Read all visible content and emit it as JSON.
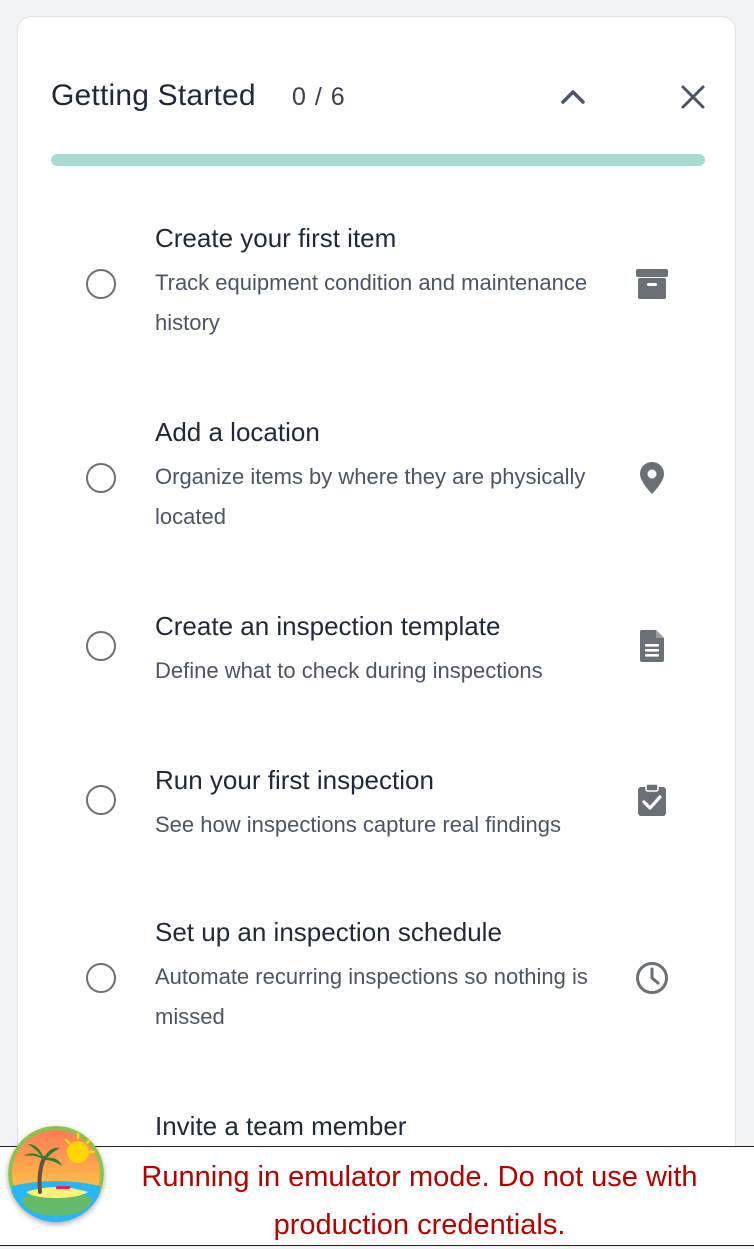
{
  "header": {
    "title": "Getting Started",
    "progress_count": "0 / 6",
    "progress_fraction": 0
  },
  "icons": {
    "collapse": "chevron-up-icon",
    "close": "close-icon"
  },
  "tasks": [
    {
      "title": "Create your first item",
      "description": "Track equipment condition and maintenance history",
      "icon": "archive-box-icon",
      "completed": false
    },
    {
      "title": "Add a location",
      "description": "Organize items by where they are physically located",
      "icon": "map-pin-icon",
      "completed": false
    },
    {
      "title": "Create an inspection template",
      "description": "Define what to check during inspections",
      "icon": "document-icon",
      "completed": false
    },
    {
      "title": "Run your first inspection",
      "description": "See how inspections capture real findings",
      "icon": "clipboard-check-icon",
      "completed": false
    },
    {
      "title": "Set up an inspection schedule",
      "description": "Automate recurring inspections so nothing is missed",
      "icon": "clock-icon",
      "completed": false
    },
    {
      "title": "Invite a team member",
      "description": "",
      "icon": "",
      "completed": false
    }
  ],
  "banner": {
    "text": "Running in emulator mode. Do not use with production credentials."
  },
  "colors": {
    "progress_track": "#a7dbd4",
    "banner_text": "#b00000",
    "icon": "#6b6f76"
  }
}
